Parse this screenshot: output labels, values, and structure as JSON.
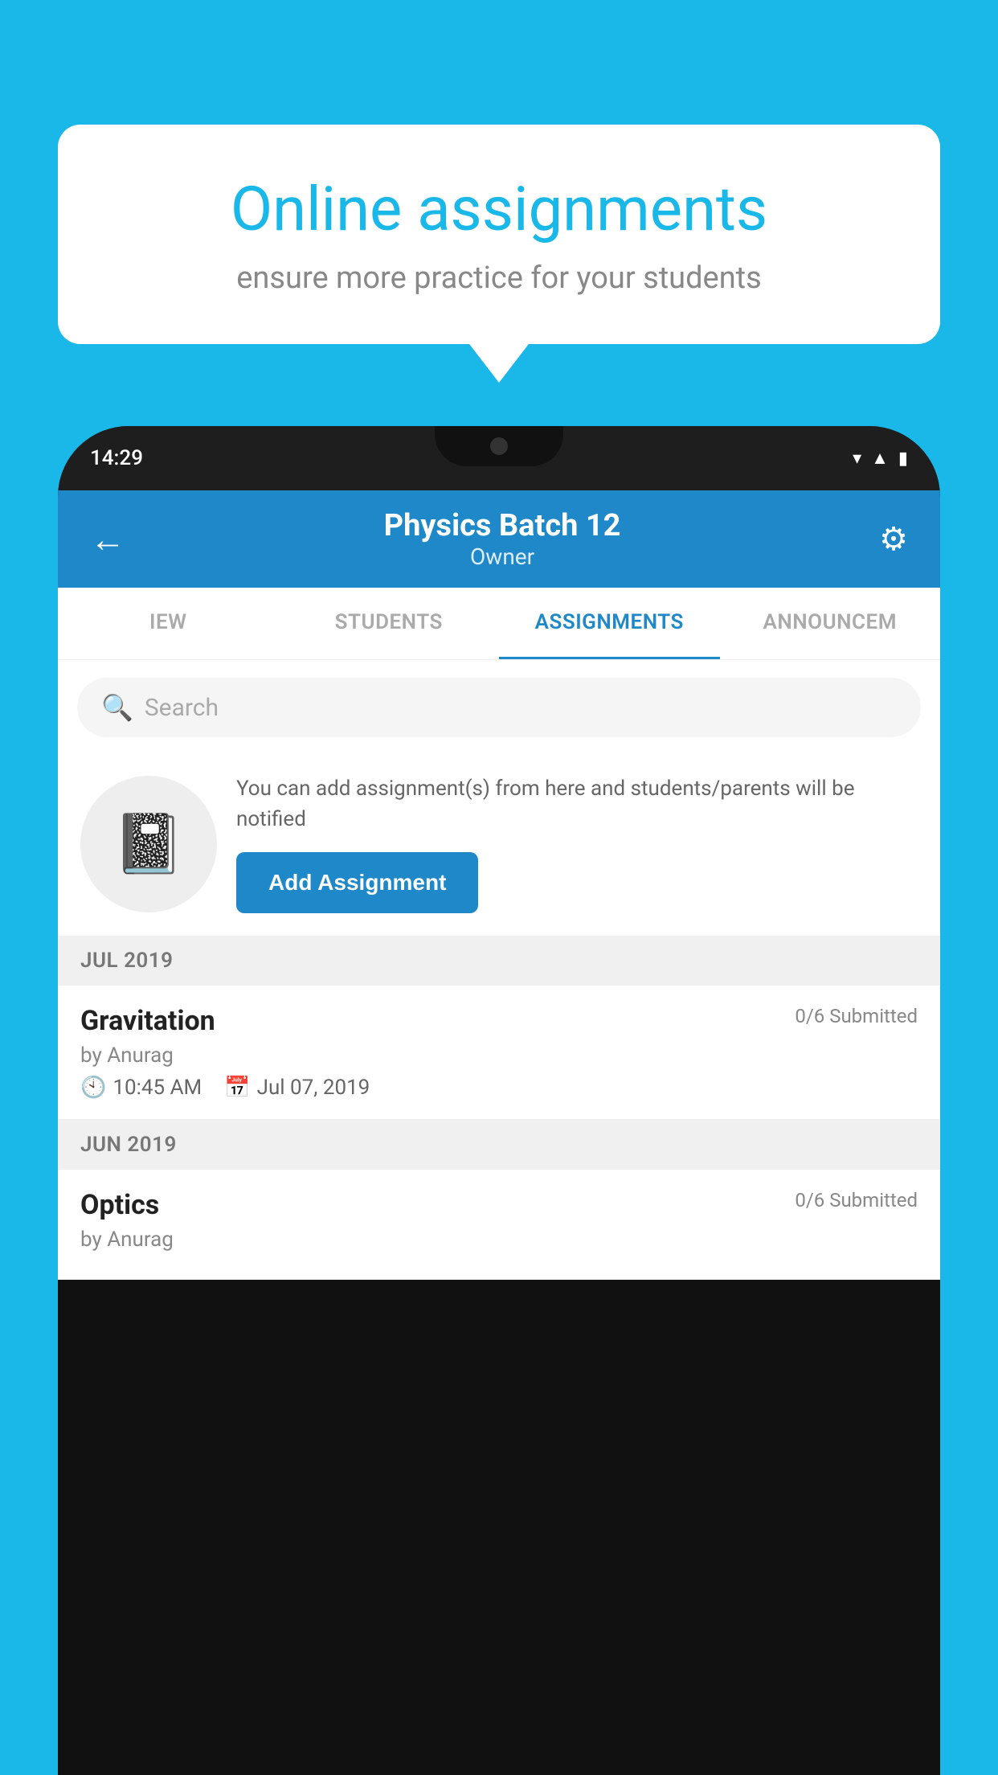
{
  "background_color": "#1ab8e8",
  "speech_bubble": {
    "title": "Online assignments",
    "subtitle": "ensure more practice for your students"
  },
  "status_bar": {
    "time": "14:29",
    "icons": [
      "wifi",
      "signal",
      "battery"
    ]
  },
  "header": {
    "title": "Physics Batch 12",
    "subtitle": "Owner",
    "back_label": "←",
    "settings_label": "⚙"
  },
  "tabs": [
    {
      "label": "IEW",
      "active": false
    },
    {
      "label": "STUDENTS",
      "active": false
    },
    {
      "label": "ASSIGNMENTS",
      "active": true
    },
    {
      "label": "ANNOUNCEM",
      "active": false
    }
  ],
  "search": {
    "placeholder": "Search"
  },
  "promo": {
    "description": "You can add assignment(s) from here and students/parents will be notified",
    "button_label": "Add Assignment"
  },
  "months": [
    {
      "label": "JUL 2019",
      "assignments": [
        {
          "name": "Gravitation",
          "submitted": "0/6 Submitted",
          "author": "by Anurag",
          "time": "10:45 AM",
          "date": "Jul 07, 2019"
        }
      ]
    },
    {
      "label": "JUN 2019",
      "assignments": [
        {
          "name": "Optics",
          "submitted": "0/6 Submitted",
          "author": "by Anurag",
          "time": "",
          "date": ""
        }
      ]
    }
  ]
}
